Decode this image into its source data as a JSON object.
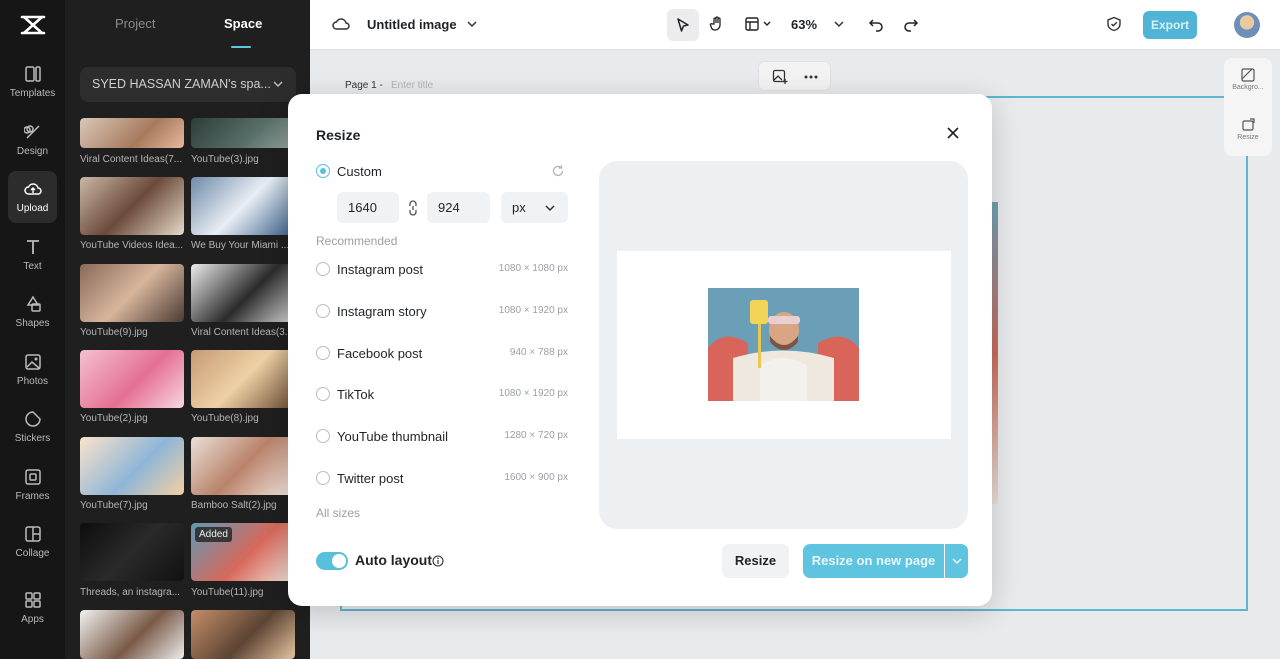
{
  "rail": {
    "items": [
      {
        "label": "Templates",
        "icon": "templates-icon"
      },
      {
        "label": "Design",
        "icon": "design-icon"
      },
      {
        "label": "Upload",
        "icon": "upload-icon"
      },
      {
        "label": "Text",
        "icon": "text-icon"
      },
      {
        "label": "Shapes",
        "icon": "shapes-icon"
      },
      {
        "label": "Photos",
        "icon": "photos-icon"
      },
      {
        "label": "Stickers",
        "icon": "stickers-icon"
      },
      {
        "label": "Frames",
        "icon": "frames-icon"
      },
      {
        "label": "Collage",
        "icon": "collage-icon"
      },
      {
        "label": "Apps",
        "icon": "apps-icon"
      }
    ]
  },
  "panel": {
    "tabs": [
      "Project",
      "Space"
    ],
    "space_name": "SYED HASSAN ZAMAN's spa...",
    "thumbs": [
      {
        "label": "Viral Content Ideas(7..."
      },
      {
        "label": "YouTube(3).jpg"
      },
      {
        "label": "YouTube Videos Idea..."
      },
      {
        "label": "We Buy Your Miami ..."
      },
      {
        "label": "YouTube(9).jpg"
      },
      {
        "label": "Viral Content Ideas(3..."
      },
      {
        "label": "YouTube(2).jpg"
      },
      {
        "label": "YouTube(8).jpg"
      },
      {
        "label": "YouTube(7).jpg"
      },
      {
        "label": "Bamboo Salt(2).jpg"
      },
      {
        "label": "Threads, an instagra..."
      },
      {
        "label": "YouTube(11).jpg"
      }
    ],
    "added_badge": "Added"
  },
  "topbar": {
    "doc_title": "Untitled image",
    "zoom": "63%",
    "export_label": "Export"
  },
  "canvas": {
    "page_label": "Page 1 -",
    "title_placeholder": "Enter title",
    "right_tools": [
      "Backgro...",
      "Resize"
    ]
  },
  "modal": {
    "title": "Resize",
    "custom_label": "Custom",
    "width": "1640",
    "height": "924",
    "unit": "px",
    "recommended_label": "Recommended",
    "options": [
      {
        "label": "Instagram post",
        "size": "1080 × 1080 px"
      },
      {
        "label": "Instagram story",
        "size": "1080 × 1920 px"
      },
      {
        "label": "Facebook post",
        "size": "940 × 788 px"
      },
      {
        "label": "TikTok",
        "size": "1080 × 1920 px"
      },
      {
        "label": "YouTube thumbnail",
        "size": "1280 × 720 px"
      },
      {
        "label": "Twitter post",
        "size": "1600 × 900 px"
      }
    ],
    "all_sizes": "All sizes",
    "auto_layout_label": "Auto layout",
    "auto_layout_on": true,
    "resize_button": "Resize",
    "resize_new_page_button": "Resize on new page"
  },
  "colors": {
    "accent": "#5ec4e0",
    "rail_bg": "#161616",
    "panel_bg": "#1f1f1f"
  }
}
